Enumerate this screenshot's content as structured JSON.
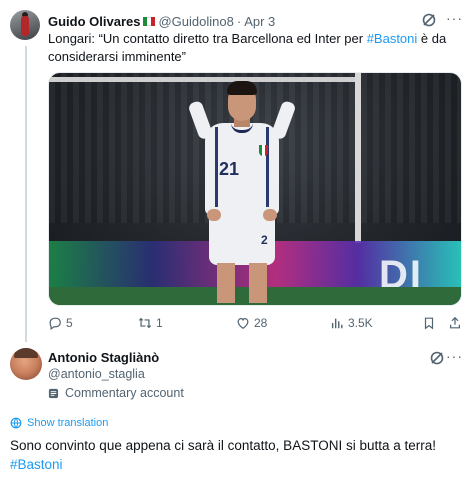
{
  "tweet1": {
    "author_name": "Guido Olivares",
    "flag_icon": "italy-flag-icon",
    "handle": "@Guidolino8",
    "separator": "·",
    "date": "Apr 3",
    "text_before": "Longari: “Un contatto diretto tra Barcellona ed Inter per ",
    "hashtag": "#Bastoni",
    "text_after": " è da considerarsi imminente”",
    "media": {
      "jersey_number": "21",
      "shorts_number": "2",
      "board_letters": "DI"
    },
    "actions": {
      "replies": "5",
      "reposts": "1",
      "likes": "28",
      "views": "3.5K"
    }
  },
  "tweet2": {
    "author_name": "Antonio Stagliànò",
    "handle": "@antonio_staglia",
    "account_type": "Commentary account",
    "translate_label": "Show translation",
    "text": "Sono convinto que appena ci sarà il contatto, BASTONI si butta a terra!",
    "hashtag": "#Bastoni"
  },
  "colors": {
    "link": "#1d9bf0",
    "secondary_text": "#536471",
    "primary_text": "#0f1419",
    "thread_line": "#cfd9de"
  }
}
